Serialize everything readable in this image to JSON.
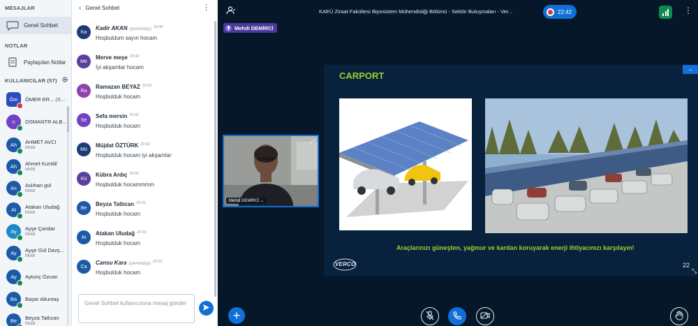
{
  "sidebar": {
    "messages_title": "MESAJLAR",
    "public_chat": "Genel Sohbet",
    "notes_title": "NOTLAR",
    "shared_notes": "Paylaşılan Notlar",
    "users_title": "KULLANICILAR (57)",
    "users": [
      {
        "initials": "Öm",
        "name": "ÖMER ER...",
        "you": "(Sen)",
        "sub": "",
        "color": "#2b4bbf",
        "shape": "square",
        "status": "red"
      },
      {
        "initials": "☺",
        "name": "OSMANTR ALB...",
        "you": "",
        "sub": "",
        "color": "#6f42c1",
        "shape": "round",
        "status": "green"
      },
      {
        "initials": "Ah",
        "name": "AHMET AVCI",
        "you": "",
        "sub": "Mobil",
        "color": "#1c5aa7",
        "shape": "round",
        "status": "green"
      },
      {
        "initials": "Ah",
        "name": "Ahmet Kızıldil",
        "you": "",
        "sub": "Mobil",
        "color": "#1c5aa7",
        "shape": "round",
        "status": "green"
      },
      {
        "initials": "As",
        "name": "Aslıhan gül",
        "you": "",
        "sub": "Mobil",
        "color": "#1c5aa7",
        "shape": "round",
        "status": "green"
      },
      {
        "initials": "At",
        "name": "Atakan Uludağ",
        "you": "",
        "sub": "Mobil",
        "color": "#1c5aa7",
        "shape": "round",
        "status": "green"
      },
      {
        "initials": "Ay",
        "name": "Ayşe Çandar",
        "you": "",
        "sub": "Mobil",
        "color": "#1c89c9",
        "shape": "round",
        "status": "green"
      },
      {
        "initials": "Ay",
        "name": "Ayşe Gül Davş...",
        "you": "",
        "sub": "Mobil",
        "color": "#1c5aa7",
        "shape": "round",
        "status": "green"
      },
      {
        "initials": "Ay",
        "name": "Aytunç Özcan",
        "you": "",
        "sub": "",
        "color": "#1c5aa7",
        "shape": "round",
        "status": "green"
      },
      {
        "initials": "Ba",
        "name": "Başar Altuntaş",
        "you": "",
        "sub": "",
        "color": "#1c5aa7",
        "shape": "round",
        "status": "green"
      },
      {
        "initials": "Be",
        "name": "Beyza Tatlıcan",
        "you": "",
        "sub": "Mobil",
        "color": "#1c5aa7",
        "shape": "round",
        "status": "green"
      }
    ]
  },
  "chat": {
    "title": "Genel Sohbet",
    "messages": [
      {
        "initials": "Ka",
        "name": "Kadir AKAN",
        "status": "(çevrimdışı)",
        "time": "19:46",
        "text": "Hoşbuldum sayın hocam",
        "color": "#1c3c78",
        "italic": true
      },
      {
        "initials": "Me",
        "name": "Merve meşe",
        "status": "",
        "time": "20:02",
        "text": "İyi akşamlar hocam",
        "color": "#5a3f9e",
        "italic": false
      },
      {
        "initials": "Ra",
        "name": "Ramazan BEYAZ",
        "status": "",
        "time": "20:02",
        "text": "Hoşbulduk hocam",
        "color": "#8e44ad",
        "italic": false
      },
      {
        "initials": "Se",
        "name": "Sefa mersin",
        "status": "",
        "time": "20:02",
        "text": "Hoşbulduk hocam",
        "color": "#6f42c1",
        "italic": false
      },
      {
        "initials": "Mü",
        "name": "Müjdat ÖZTÜRK",
        "status": "",
        "time": "20:02",
        "text": "Hoşbulduk hocam iyi akşamlar",
        "color": "#1c3c78",
        "italic": false
      },
      {
        "initials": "Kü",
        "name": "Kübra Ardıç",
        "status": "",
        "time": "20:02",
        "text": "Hoşbulduk hocammmm",
        "color": "#5a3f9e",
        "italic": false
      },
      {
        "initials": "Be",
        "name": "Beyza Tatlıcan",
        "status": "",
        "time": "20:02",
        "text": "Hoşbulduk hocam",
        "color": "#1c5aa7",
        "italic": false
      },
      {
        "initials": "At",
        "name": "Atakan Uludağ",
        "status": "",
        "time": "20:02",
        "text": "Hoşbulduk hocam",
        "color": "#1c5aa7",
        "italic": false
      },
      {
        "initials": "Ca",
        "name": "Cansu Kara",
        "status": "(çevrimdışı)",
        "time": "20:02",
        "text": "Hoşbulduk hocam",
        "color": "#1c5aa7",
        "italic": true
      }
    ],
    "input_placeholder": "Genel Sohbet kullanıcısına mesaj gönder"
  },
  "header": {
    "title": "KAEÜ Ziraat Fakültesi Biyosistem Mühendisliği Bölümü - Sektör Buluşmaları - Ver...",
    "recording_time": "22:42",
    "talking": "Mehdi DEMİRCİ"
  },
  "webcam": {
    "name": "Mehdi DEMİRCİ"
  },
  "slide": {
    "title": "CARPORT",
    "caption": "Araçlarınızı güneşten, yağmur ve kardan koruyarak enerji ihtiyacınızı karşılayın!",
    "logo": "VERCO",
    "page": "22"
  },
  "colors": {
    "accent": "#0f70d7",
    "stage_bg": "#06172a",
    "slide_bg": "#08213c",
    "slide_green": "#9ad12f",
    "online": "#0f8a4e",
    "recording": "#d9363e"
  },
  "icons": {
    "public_chat": "chat-bubble-icon",
    "shared_notes": "notes-icon",
    "users_settings": "gear-icon",
    "manage_users": "users-icon",
    "connection": "signal-icon",
    "options": "kebab-icon",
    "actions": "plus-icon",
    "mic": "mic-muted-icon",
    "audio": "phone-icon",
    "video": "camera-off-icon",
    "raise_hand": "hand-icon",
    "send": "send-icon",
    "fullscreen": "fullscreen-icon"
  }
}
